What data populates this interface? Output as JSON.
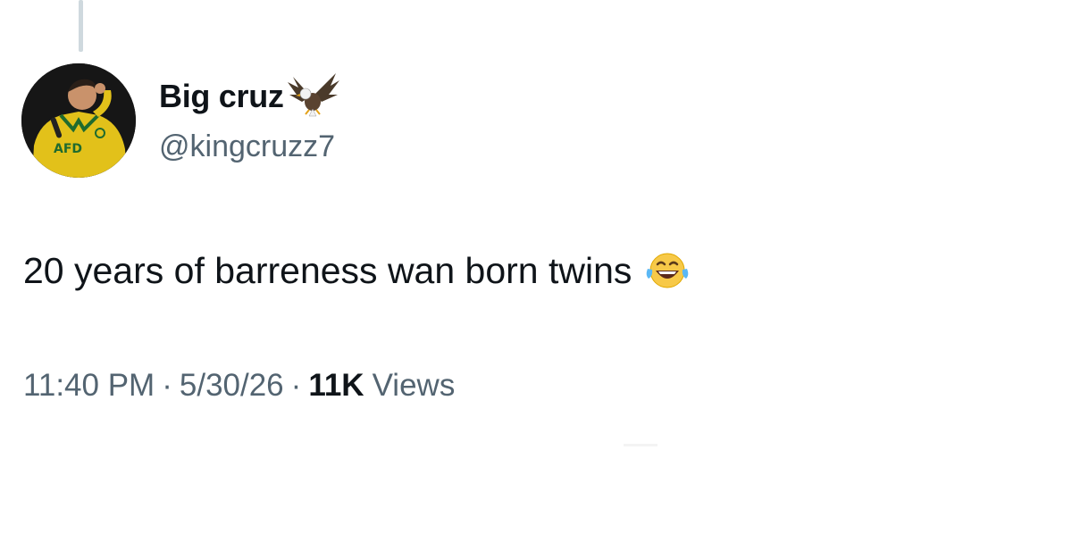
{
  "author": {
    "display_name": "Big cruz",
    "handle": "@kingcruzz7",
    "badge_icon": "eagle-icon",
    "avatar_icon": "profile-photo"
  },
  "tweet": {
    "text": "20 years of barreness wan born twins",
    "emoji_icon": "tears-of-joy-icon"
  },
  "meta": {
    "time": "11:40 PM",
    "separator": "·",
    "date": "5/30/26",
    "views_count": "11K",
    "views_label": "Views"
  },
  "colors": {
    "text_primary": "#0f1419",
    "text_secondary": "#536471",
    "thread_line": "#cfd9de",
    "shirt_yellow": "#e6c200"
  }
}
